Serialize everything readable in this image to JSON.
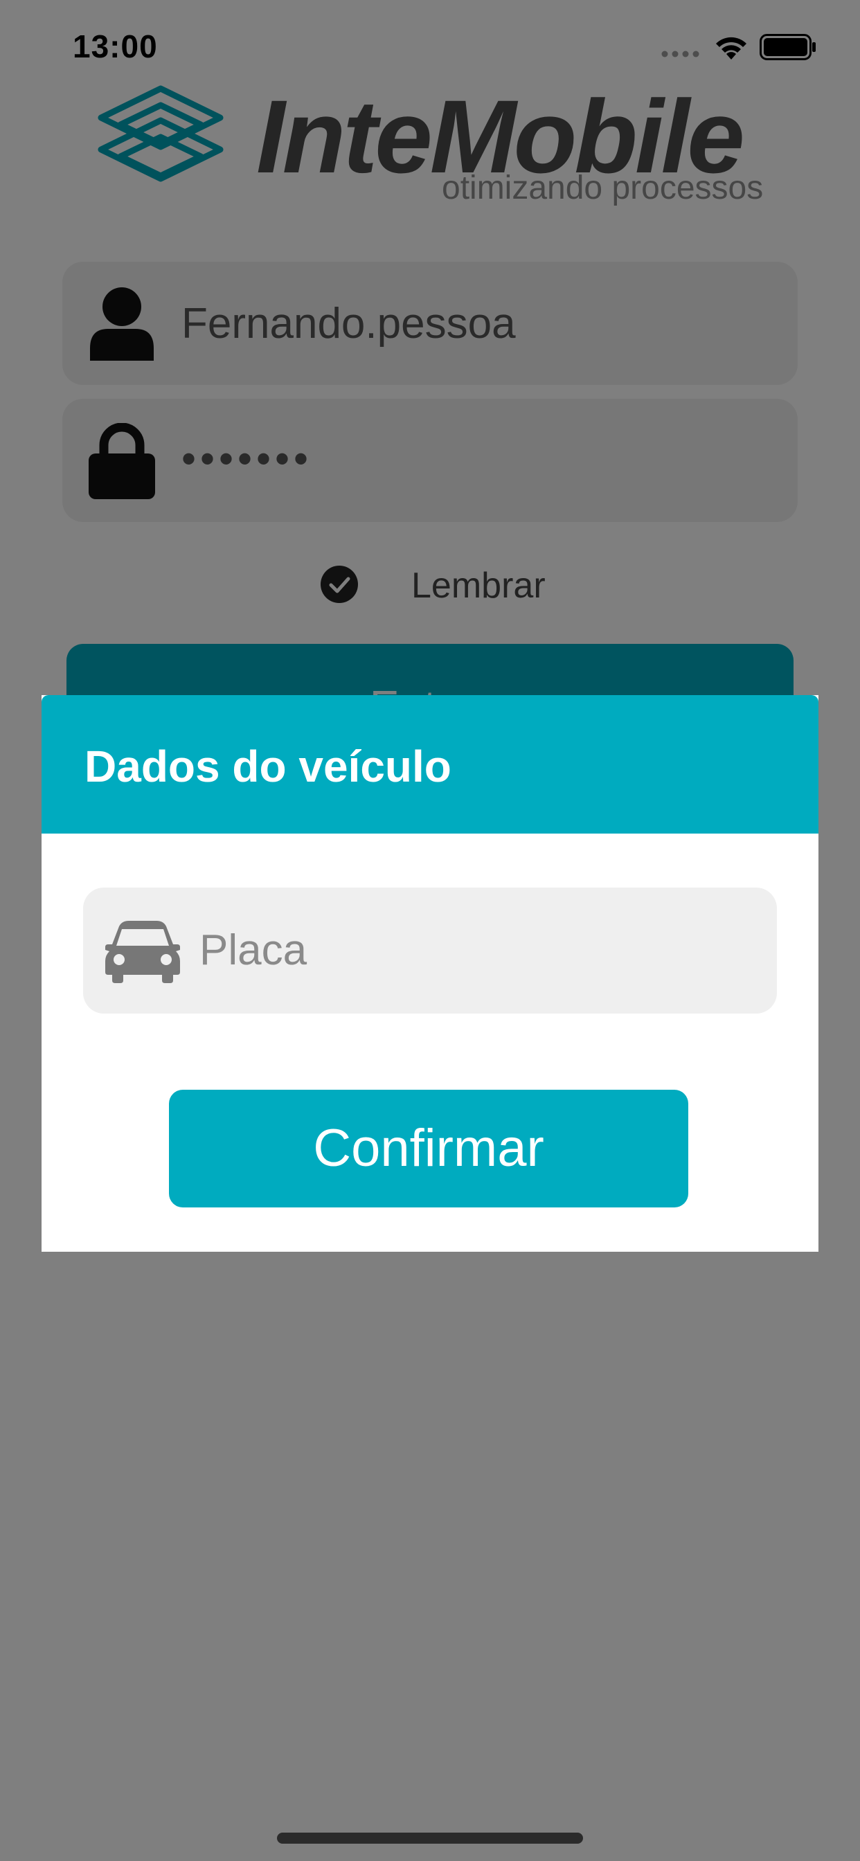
{
  "status_bar": {
    "time": "13:00"
  },
  "logo": {
    "name": "InteMobile",
    "tagline": "otimizando processos"
  },
  "login_form": {
    "username_value": "Fernando.pessoa",
    "password_value": "•••••••",
    "remember_label": "Lembrar",
    "remember_checked": true,
    "login_button_label": "Entrar"
  },
  "dialog": {
    "title": "Dados do veículo",
    "plate_placeholder": "Placa",
    "plate_value": "",
    "confirm_label": "Confirmar"
  },
  "colors": {
    "accent": "#00abbf",
    "overlay": "rgba(0,0,0,0.5)",
    "field_background": "#efefef"
  },
  "icons": {
    "username": "user-icon",
    "password": "lock-icon",
    "remember": "check-circle-icon",
    "plate": "car-icon"
  }
}
